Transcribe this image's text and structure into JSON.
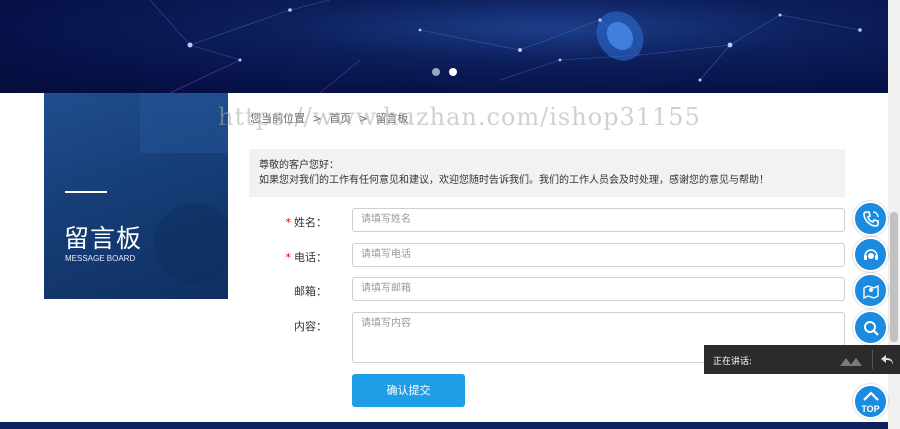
{
  "breadcrumb": {
    "home": "您当前位置",
    "sep": ">",
    "current": "留言板",
    "first": "首页"
  },
  "watermark": "https://www.huzhan.com/ishop31155",
  "side_panel": {
    "title_cn": "留言板",
    "title_en": "MESSAGE BOARD"
  },
  "notice": {
    "line1": "尊敬的客户您好：",
    "line2": "如果您对我们的工作有任何意见和建议，欢迎您随时告诉我们。我们的工作人员会及时处理，感谢您的意见与帮助！"
  },
  "form": {
    "name": {
      "label": "姓名：",
      "required": "*",
      "placeholder": "请填写姓名"
    },
    "phone": {
      "label": "电话：",
      "required": "*",
      "placeholder": "请填写电话"
    },
    "email": {
      "label": "邮箱：",
      "placeholder": "请填写邮箱"
    },
    "content": {
      "label": "内容：",
      "placeholder": "请填写内容"
    },
    "submit": "确认提交"
  },
  "chat": {
    "status": "正在讲话:"
  },
  "float": {
    "top_label": "TOP"
  },
  "colors": {
    "accent": "#1f9de6",
    "banner": "#07124a",
    "side": "#163e77"
  }
}
